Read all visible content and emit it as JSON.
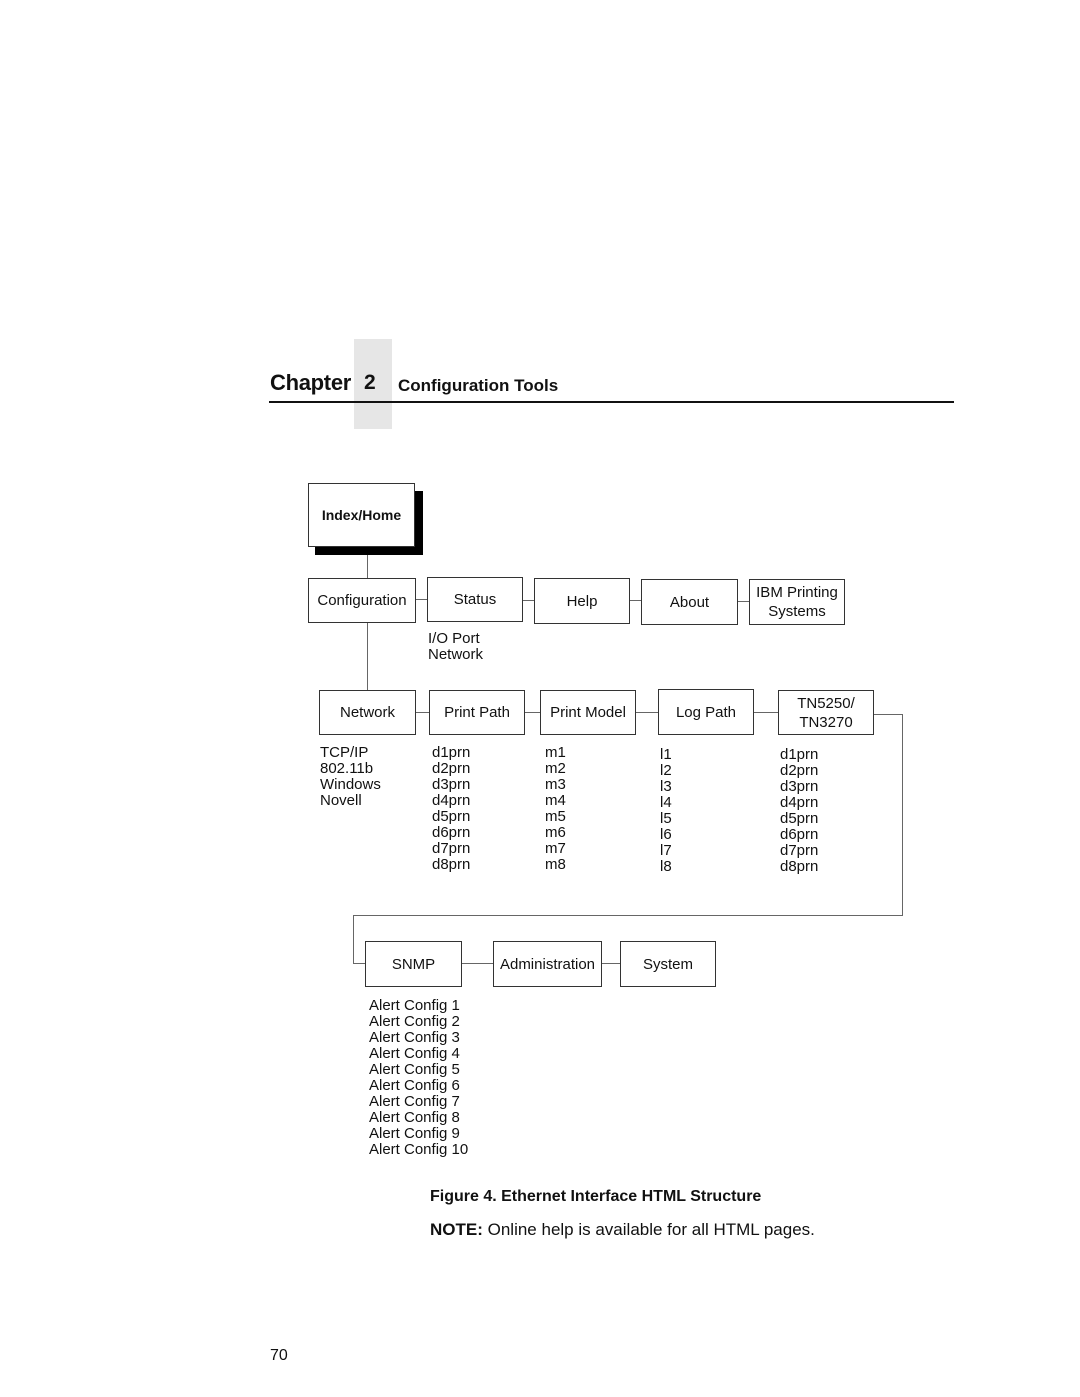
{
  "header": {
    "chapter_word": "Chapter",
    "chapter_number": "2",
    "chapter_title": "Configuration Tools"
  },
  "diagram": {
    "root": "Index/Home",
    "level1": [
      "Configuration",
      "Status",
      "Help",
      "About",
      "IBM Printing Systems"
    ],
    "status_children": [
      "I/O Port",
      "Network"
    ],
    "level2": [
      "Network",
      "Print Path",
      "Print Model",
      "Log Path",
      "TN5250/ TN3270"
    ],
    "network_children": [
      "TCP/IP",
      "802.11b",
      "Windows",
      "Novell"
    ],
    "print_path_children": [
      "d1prn",
      "d2prn",
      "d3prn",
      "d4prn",
      "d5prn",
      "d6prn",
      "d7prn",
      "d8prn"
    ],
    "print_model_children": [
      "m1",
      "m2",
      "m3",
      "m4",
      "m5",
      "m6",
      "m7",
      "m8"
    ],
    "log_path_children": [
      "l1",
      "l2",
      "l3",
      "l4",
      "l5",
      "l6",
      "l7",
      "l8"
    ],
    "tn_children": [
      "d1prn",
      "d2prn",
      "d3prn",
      "d4prn",
      "d5prn",
      "d6prn",
      "d7prn",
      "d8prn"
    ],
    "level3": [
      "SNMP",
      "Administration",
      "System"
    ],
    "snmp_children": [
      "Alert Config 1",
      "Alert Config 2",
      "Alert Config 3",
      "Alert Config 4",
      "Alert Config 5",
      "Alert Config 6",
      "Alert Config 7",
      "Alert Config 8",
      "Alert Config 9",
      "Alert Config 10"
    ]
  },
  "caption": "Figure 4. Ethernet Interface HTML Structure",
  "note": {
    "label": "NOTE:",
    "text": "Online help is available for all HTML pages."
  },
  "page_number": "70"
}
